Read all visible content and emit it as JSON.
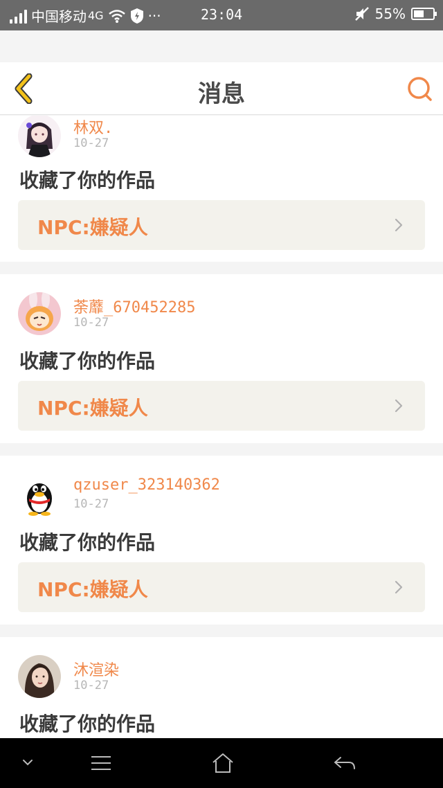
{
  "status_bar": {
    "carrier": "中国移动",
    "network": "4G",
    "extra": "···",
    "time": "23:04",
    "battery": "55%",
    "battery_level": 0.55
  },
  "header": {
    "title": "消息",
    "back_icon": "back-chevron-icon",
    "search_icon": "search-icon",
    "accent_color": "#f0884a",
    "back_color": "#f3c21b"
  },
  "feed": {
    "items": [
      {
        "username": "林双.",
        "date": "10-27",
        "action": "收藏了你的作品",
        "work_title": "NPC:嫌疑人",
        "avatar": "anime-girl-avatar"
      },
      {
        "username": "荼蘼_670452285",
        "date": "10-27",
        "action": "收藏了你的作品",
        "work_title": "NPC:嫌疑人",
        "avatar": "anime-bunny-avatar"
      },
      {
        "username": "qzuser_323140362",
        "date": "10-27",
        "action": "收藏了你的作品",
        "work_title": "NPC:嫌疑人",
        "avatar": "qq-penguin-avatar"
      },
      {
        "username": "沐渲染",
        "date": "10-27",
        "action": "收藏了你的作品",
        "work_title": "",
        "avatar": "photo-avatar"
      }
    ]
  },
  "system_nav": {
    "icons": [
      "chevron-down-icon",
      "menu-icon",
      "home-icon",
      "back-arrow-icon"
    ]
  }
}
